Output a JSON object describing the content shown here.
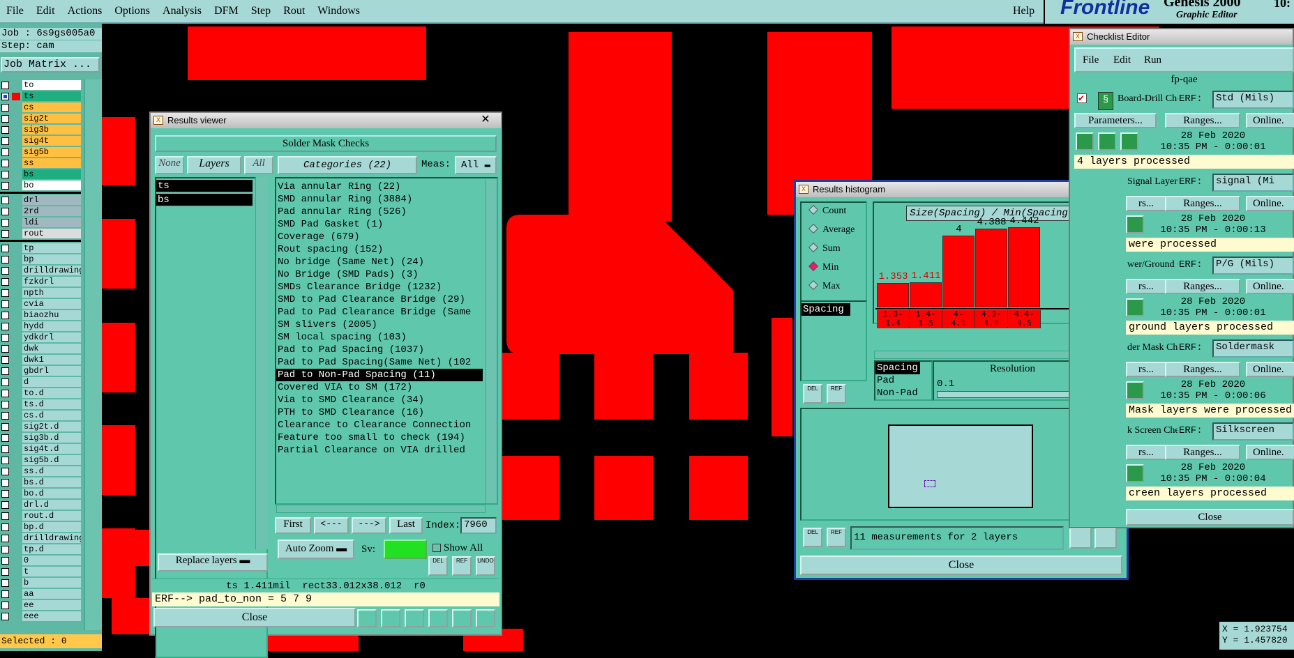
{
  "menubar": {
    "items": [
      "File",
      "Edit",
      "Actions",
      "Options",
      "Analysis",
      "DFM",
      "Step",
      "Rout",
      "Windows"
    ],
    "help": "Help"
  },
  "brand": {
    "logo": "Frontline",
    "product": "Genesis 2000",
    "subtitle": "Graphic Editor",
    "time": "10:"
  },
  "left_panel": {
    "job": "Job : 6s9gs005a0",
    "step": "Step: cam",
    "job_matrix": "Job Matrix ...",
    "layers_group1": [
      {
        "name": "to",
        "color": "#ffffff"
      },
      {
        "name": "ts",
        "color": "#1fae7f",
        "active": true
      },
      {
        "name": "cs",
        "color": "#ffbf40"
      },
      {
        "name": "sig2t",
        "color": "#ffbf40"
      },
      {
        "name": "sig3b",
        "color": "#ffbf40"
      },
      {
        "name": "sig4t",
        "color": "#ffbf40"
      },
      {
        "name": "sig5b",
        "color": "#ffbf40"
      },
      {
        "name": "ss",
        "color": "#ffbf40"
      },
      {
        "name": "bs",
        "color": "#1fae7f"
      },
      {
        "name": "bo",
        "color": "#ffffff"
      }
    ],
    "layers_group2": [
      {
        "name": "drl",
        "color": "#a0b8c0"
      },
      {
        "name": "2rd",
        "color": "#a0b8c0"
      },
      {
        "name": "ldi",
        "color": "#a0b8c0"
      },
      {
        "name": "rout",
        "color": "#dcdcdc"
      }
    ],
    "layers_group3": [
      "tp",
      "bp",
      "drilldrawing",
      "fzkdrl",
      "npth",
      "cvia",
      "biaozhu",
      "hydd",
      "ydkdrl",
      "dwk",
      "dwk1",
      "gbdrl",
      "d",
      "to.d",
      "ts.d",
      "cs.d",
      "sig2t.d",
      "sig3b.d",
      "sig4t.d",
      "sig5b.d",
      "ss.d",
      "bs.d",
      "bo.d",
      "drl.d",
      "rout.d",
      "bp.d",
      "drilldrawing",
      "tp.d",
      "0",
      "t",
      "b",
      "aa",
      "ee",
      "eee"
    ],
    "selected": "Selected : 0"
  },
  "results_viewer": {
    "title": "Results viewer",
    "header": "Solder Mask Checks",
    "btn_none": "None",
    "btn_layers": "Layers",
    "btn_all": "All",
    "categories_btn": "Categories (22)",
    "meas_label": "Meas:",
    "meas_value": "All",
    "layers": [
      "ts",
      "bs"
    ],
    "categories": [
      "Via annular Ring (22)",
      "SMD annular Ring (3884)",
      "Pad annular Ring (526)",
      "SMD Pad Gasket (1)",
      "Coverage (679)",
      "Rout spacing (152)",
      "No bridge (Same Net) (24)",
      "No Bridge (SMD Pads) (3)",
      "SMDs Clearance Bridge (1232)",
      "SMD to Pad Clearance Bridge (29)",
      "Pad to Pad Clearance Bridge (Same",
      "SM slivers (2005)",
      "SM local spacing (103)",
      "Pad to Pad Spacing (1037)",
      "Pad to Pad Spacing(Same Net) (102",
      "Pad to Non-Pad Spacing (11)",
      "Covered VIA to SM (172)",
      "Via to SMD Clearance (34)",
      "PTH to SMD Clearance (16)",
      "Clearance to Clearance Connection",
      "Feature too small to check (194)",
      "Partial Clearance on VIA drilled"
    ],
    "selected_category": 15,
    "nav": {
      "first": "First",
      "prev": "<---",
      "next": "--->",
      "last": "Last",
      "index_label": "Index:",
      "index_value": "7960"
    },
    "auto_zoom": "Auto Zoom",
    "sv_label": "Sv:",
    "show_all": "Show All",
    "replace_layers": "Replace layers",
    "icons": {
      "del": "DEL",
      "ref": "REF",
      "undo": "UNDO"
    },
    "status": "ts 1.411mil  rect33.012x38.012  r0",
    "erf": "ERF--> pad_to_non = 5 7 9",
    "close": "Close"
  },
  "histogram": {
    "title": "Results histogram",
    "modes": [
      "Count",
      "Average",
      "Sum",
      "Min",
      "Max"
    ],
    "selected_mode": "Min",
    "chart_title": "Size(Spacing) / Min(Spacing)",
    "list_item": "Spacing",
    "types": [
      "Spacing",
      "Pad",
      "Non-Pad"
    ],
    "resolution_label": "Resolution",
    "resolution_value": "0.1",
    "measurements": "11 measurements for 2 layers",
    "close": "Close",
    "icons": {
      "del": "DEL",
      "ref": "REF"
    }
  },
  "chart_data": {
    "type": "bar",
    "title": "Size(Spacing) / Min(Spacing)",
    "categories": [
      "1.3-\n1.4",
      "1.4-\n1.5",
      "4-\n4.1",
      "4.3-\n4.4",
      "4.4-\n4.5"
    ],
    "values": [
      1.353,
      1.411,
      4,
      4.388,
      4.442
    ],
    "value_labels": [
      "1.353",
      "1.411",
      "4",
      "4.388",
      "4.442"
    ],
    "value_label_colors": [
      "#d00",
      "#d00",
      "#000",
      "#000",
      "#000"
    ],
    "ylim": [
      0,
      4.8
    ]
  },
  "checklist": {
    "title": "Checklist Editor",
    "menu": [
      "File",
      "Edit",
      "Run"
    ],
    "name": "fp-qae",
    "erf_label": "ERF:",
    "parameters": "Parameters...",
    "ranges": "Ranges...",
    "online": "Online.",
    "close": "Close",
    "rows": [
      {
        "name": "Board-Drill Che",
        "erf": "Std (Mils)",
        "date": "28 Feb 2020",
        "time": "10:35 PM - 0:00:01",
        "msg": "4 layers processed",
        "btn1": "Parameters..."
      },
      {
        "name": "Signal Layer Ch",
        "erf": "signal (Mi",
        "date": "28 Feb 2020",
        "time": "10:35 PM - 0:00:13",
        "msg": "were processed",
        "btn1": "rs..."
      },
      {
        "name": "wer/Ground C",
        "erf": "P/G (Mils)",
        "date": "28 Feb 2020",
        "time": "10:35 PM - 0:00:01",
        "msg": "ground layers processed",
        "btn1": "rs..."
      },
      {
        "name": "der Mask Ch",
        "erf": "Soldermask",
        "date": "28 Feb 2020",
        "time": "10:35 PM - 0:00:06",
        "msg": "Mask layers were processed",
        "btn1": "rs..."
      },
      {
        "name": "k Screen Che",
        "erf": "Silkscreen",
        "date": "28 Feb 2020",
        "time": "10:35 PM - 0:00:04",
        "msg": "creen layers processed",
        "btn1": "rs..."
      }
    ]
  },
  "coords": {
    "x": "X = 1.923754",
    "y": "Y = 1.457820"
  }
}
